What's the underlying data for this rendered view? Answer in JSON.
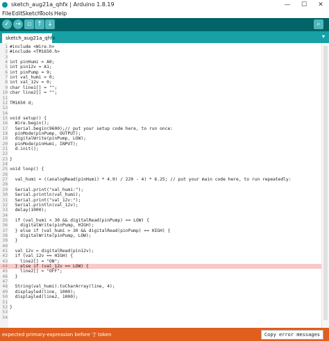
{
  "window": {
    "title": "sketch_aug21a_qhfx | Arduino 1.8.19",
    "controls": [
      "—",
      "☐",
      "✕"
    ]
  },
  "menu": [
    "File",
    "Edit",
    "Sketch",
    "Tools",
    "Help"
  ],
  "toolbar": {
    "buttons": [
      {
        "name": "verify-button",
        "glyph": "✓"
      },
      {
        "name": "upload-button",
        "glyph": "→"
      },
      {
        "name": "new-button",
        "glyph": "▫"
      },
      {
        "name": "open-button",
        "glyph": "↑"
      },
      {
        "name": "save-button",
        "glyph": "↓"
      }
    ],
    "serial_glyph": "⌕"
  },
  "tabs": {
    "active": "sketch_aug21a_qhfx",
    "menu_glyph": "▾"
  },
  "editor": {
    "highlight_line": 44,
    "lines": [
      "#include <Wire.h>",
      "#include <TM1650.h>",
      "",
      "int pinHumi = A0;",
      "int pin12v = A1;",
      "int pinPump = 9;",
      "int val_humi = 0;",
      "int val_12v = 0;",
      "char line1[] = \"\";",
      "char line2[] = \"\";",
      "",
      "TM1650 d;",
      "",
      "",
      "void setup() {",
      "  Wire.begin();",
      "  Serial.begin(9600);// put your setup code here, to run once:",
      "  pinMode(pinPump, OUTPUT);",
      "  digitalWrite(pinPump, LOW);",
      "  pinMode(pinHumi, INPUT);",
      "  d.init();",
      "",
      "}",
      "",
      "void loop() {",
      "",
      "  val_humi = ((analogRead(pinHumi) * 4.9) / 220 - 4) * 6.25; // put your main code here, to run repeatedly:",
      "",
      "  Serial.print(\"val_humi:\");",
      "  Serial.println(val_humi);",
      "  Serial.print(\"val_12v:\");",
      "  Serial.println(val_12v);",
      "  delay(1000);",
      "",
      "  if (val_humi < 30 && digitalRead(pinPump) == LOW) {",
      "    digitalWrite(pinPump, HIGH);",
      "  } else if (val_humi > 30 && digitalRead(pinPump) == HIGH) {",
      "    digitalWrite(pinPump, LOW);",
      "  }",
      "",
      "  val_12v = digitalRead(pin12v);",
      "  if (val_12v == HIGH) {",
      "    line2[] = \"ON\";",
      "  } else if (val_12v == LOW) {",
      "    line2[] = \"OFF\";",
      "  }",
      "",
      "  String(val_humi).toCharArray(line, 4);",
      "  displayled(line, 1000);",
      "  displayled(line2, 1000);",
      "",
      "}",
      "",
      ""
    ]
  },
  "status": {
    "message": "expected primary-expression before ']' token",
    "copy_button": "Copy error messages"
  }
}
